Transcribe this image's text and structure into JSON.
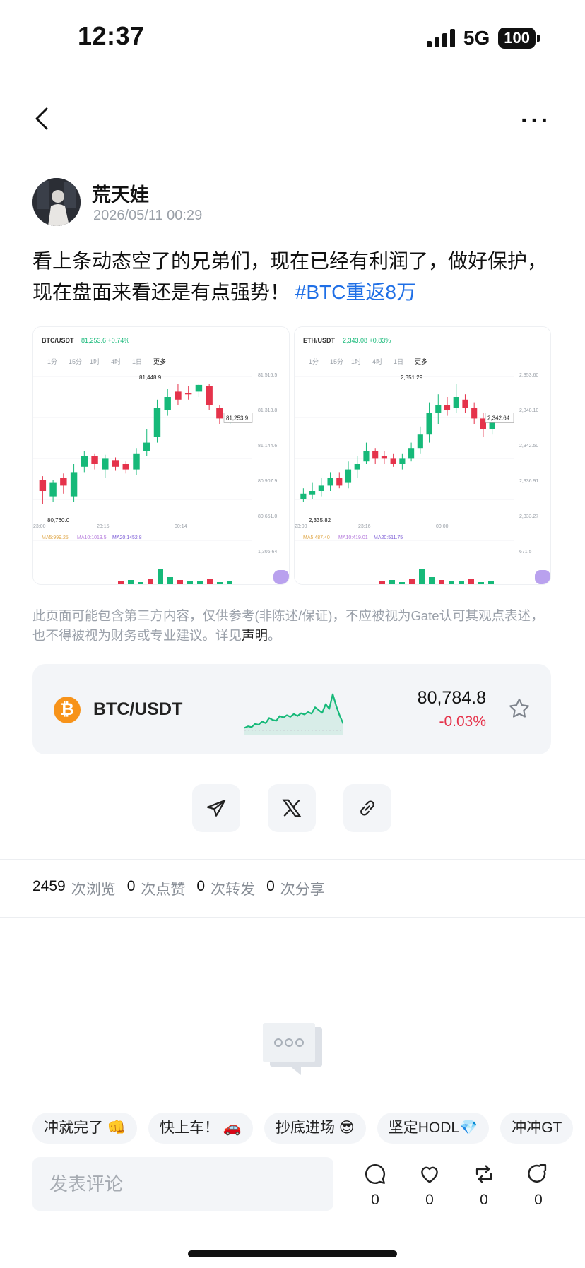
{
  "status_bar": {
    "time": "12:37",
    "network": "5G",
    "battery": "100"
  },
  "post": {
    "author": "荒天娃",
    "timestamp": "2026/05/11 00:29",
    "text": "看上条动态空了的兄弟们，现在已经有利润了，做好保护，现在盘面来看还是有点强势！",
    "hashtag": "#BTC重返8万"
  },
  "images": [
    {
      "pair": "BTC/USDT",
      "price_line": "81,253.6 +0.74%",
      "tabs": [
        "1分",
        "15分",
        "1时",
        "4时",
        "1日",
        "更多"
      ],
      "high_label": "81,448.9",
      "last_label": "81,253.9",
      "low_label": "80,760.0",
      "axis": [
        "81,516.5",
        "81,313.8",
        "81,144.6",
        "80,907.9",
        "80,651.0",
        "1,306.64"
      ],
      "times": [
        "23:00",
        "23:15",
        "00:14"
      ],
      "ma_line": [
        "MA5:999.25",
        "MA10:1013.5",
        "MA20:1452.8"
      ]
    },
    {
      "pair": "ETH/USDT",
      "price_line": "2,343.08 +0.83%",
      "tabs": [
        "1分",
        "15分",
        "1时",
        "4时",
        "1日",
        "更多"
      ],
      "high_label": "2,351.29",
      "last_label": "2,342.64",
      "low_label": "2,335.82",
      "axis": [
        "2,353.60",
        "2,348.10",
        "2,342.50",
        "2,336.91",
        "2,333.27",
        "671.5"
      ],
      "times": [
        "23:00",
        "23:16",
        "00:00"
      ],
      "ma_line": [
        "MA5:487.40",
        "MA10:419.01",
        "MA20:511.75"
      ]
    }
  ],
  "disclaimer": {
    "text": "此页面可能包含第三方内容，仅供参考(非陈述/保证)，不应被视为Gate认可其观点表述，也不得被视为财务或专业建议。详见",
    "link": "声明",
    "end": "。"
  },
  "ticker": {
    "pair": "BTC/USDT",
    "price": "80,784.8",
    "change": "-0.03%",
    "coin_letter": "₿"
  },
  "ticker_sparkline": [
    0.1,
    0.14,
    0.12,
    0.2,
    0.18,
    0.26,
    0.22,
    0.35,
    0.3,
    0.28,
    0.4,
    0.36,
    0.42,
    0.38,
    0.45,
    0.4,
    0.47,
    0.44,
    0.5,
    0.46,
    0.62,
    0.55,
    0.48,
    0.7,
    0.58,
    0.95,
    0.65,
    0.4,
    0.2
  ],
  "share": {
    "items": [
      "telegram-icon",
      "x-icon",
      "link-icon"
    ]
  },
  "stats": [
    {
      "num": "2459",
      "label": "次浏览"
    },
    {
      "num": "0",
      "label": "次点赞"
    },
    {
      "num": "0",
      "label": "次转发"
    },
    {
      "num": "0",
      "label": "次分享"
    }
  ],
  "quick_replies": [
    "冲就完了 👊",
    "快上车！ 🚗",
    "抄底进场 😎",
    "坚定HODL💎",
    "冲冲GT"
  ],
  "comment": {
    "placeholder": "发表评论"
  },
  "actions": [
    {
      "icon": "comment-icon",
      "count": "0"
    },
    {
      "icon": "like-icon",
      "count": "0"
    },
    {
      "icon": "repost-icon",
      "count": "0"
    },
    {
      "icon": "share-icon",
      "count": "0"
    }
  ],
  "colors": {
    "hashtag": "#1f6fe6",
    "up": "#16b979",
    "down": "#e5334b",
    "coin": "#f7931a"
  }
}
